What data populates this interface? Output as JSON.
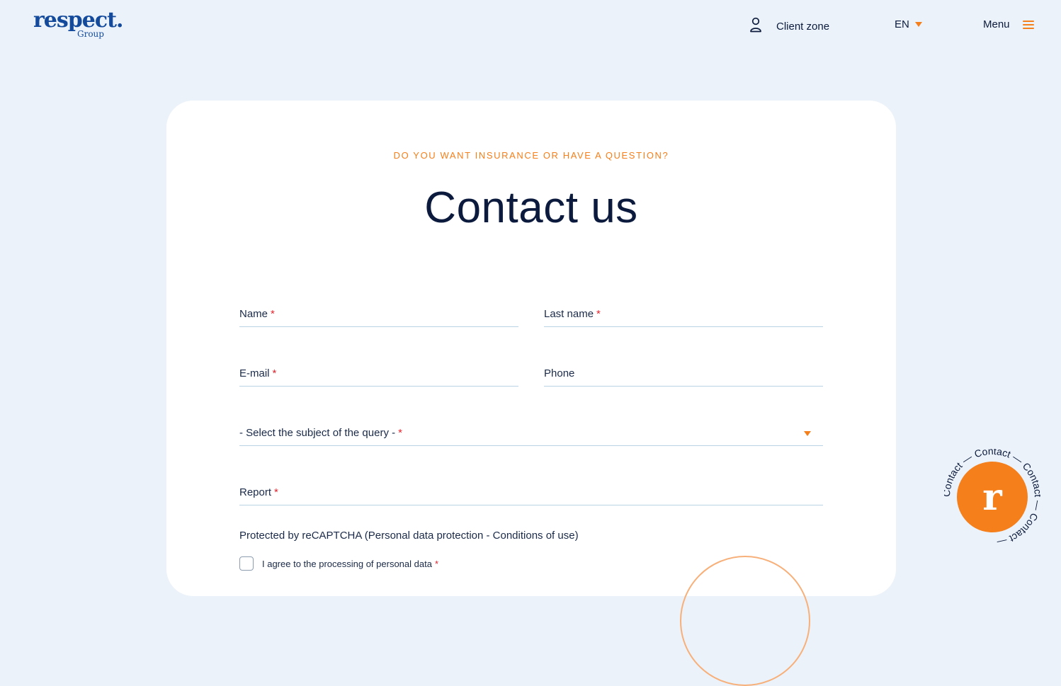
{
  "header": {
    "logo_word": "respect.",
    "logo_sub": "Group",
    "client_zone": "Client zone",
    "language": "EN",
    "menu": "Menu"
  },
  "contact": {
    "eyebrow": "DO YOU WANT INSURANCE OR HAVE A QUESTION?",
    "title": "Contact us",
    "fields": {
      "name": {
        "label": "Name",
        "required": "*"
      },
      "last_name": {
        "label": "Last name",
        "required": "*"
      },
      "email": {
        "label": "E-mail",
        "required": "*"
      },
      "phone": {
        "label": "Phone"
      },
      "subject": {
        "label": "- Select the subject of the query -",
        "required": "*"
      },
      "report": {
        "label": "Report",
        "required": "*"
      }
    },
    "recaptcha_note": "Protected by reCAPTCHA (Personal data protection - Conditions of use)",
    "consent": {
      "label": "I agree to the processing of personal data",
      "required": "*"
    }
  },
  "badge": {
    "letter": "r",
    "ring_text": "Contact — Contact — Contact — Contact —"
  },
  "colors": {
    "background": "#ebf2f9",
    "accent": "#f47f1b",
    "brand": "#134a9c",
    "text": "#0c1b3d",
    "required": "#e0262e"
  },
  "icons": [
    "user-icon",
    "caret-down-icon",
    "hamburger-icon"
  ]
}
